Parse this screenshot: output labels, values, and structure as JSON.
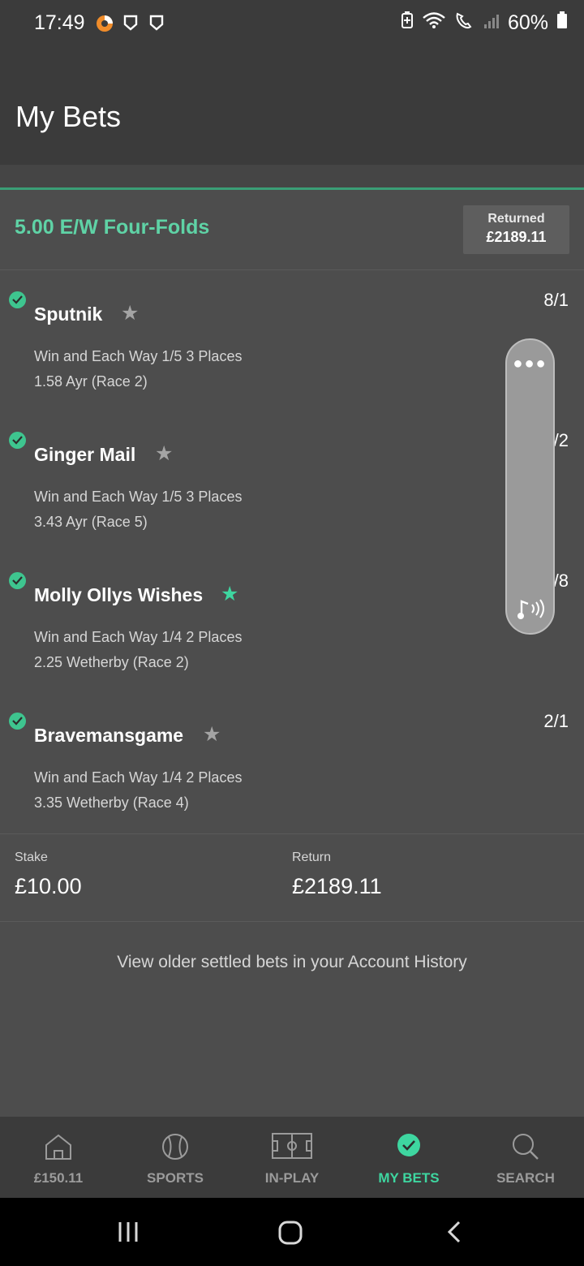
{
  "status_bar": {
    "time": "17:49",
    "battery": "60%"
  },
  "header": {
    "title": "My Bets"
  },
  "bet": {
    "title": "5.00 E/W Four-Folds",
    "returned_label": "Returned",
    "returned_value": "£2189.11",
    "selections": [
      {
        "name": "Sputnik",
        "terms": "Win and Each Way 1/5 3 Places",
        "race": "1.58 Ayr (Race 2)",
        "odds": "8/1",
        "favourite": false
      },
      {
        "name": "Ginger Mail",
        "terms": "Win and Each Way 1/5 3 Places",
        "race": "3.43 Ayr (Race 5)",
        "odds": "/2",
        "favourite": false
      },
      {
        "name": "Molly Ollys Wishes",
        "terms": "Win and Each Way 1/4 2 Places",
        "race": "2.25 Wetherby (Race 2)",
        "odds": "/8",
        "favourite": true
      },
      {
        "name": "Bravemansgame",
        "terms": "Win and Each Way 1/4 2 Places",
        "race": "3.35 Wetherby (Race 4)",
        "odds": "2/1",
        "favourite": false
      }
    ],
    "stake_label": "Stake",
    "stake_value": "£10.00",
    "return_label": "Return",
    "return_value": "£2189.11"
  },
  "history_link": "View older settled bets in your Account History",
  "bottom_nav": [
    {
      "label": "£150.11",
      "icon": "home-icon"
    },
    {
      "label": "SPORTS",
      "icon": "ball-icon"
    },
    {
      "label": "IN-PLAY",
      "icon": "pitch-icon"
    },
    {
      "label": "MY BETS",
      "icon": "check-circle-icon",
      "active": true
    },
    {
      "label": "SEARCH",
      "icon": "search-icon"
    }
  ],
  "colors": {
    "accent": "#3ed6a0",
    "background": "#4d4d4d",
    "header": "#3b3b3b"
  }
}
